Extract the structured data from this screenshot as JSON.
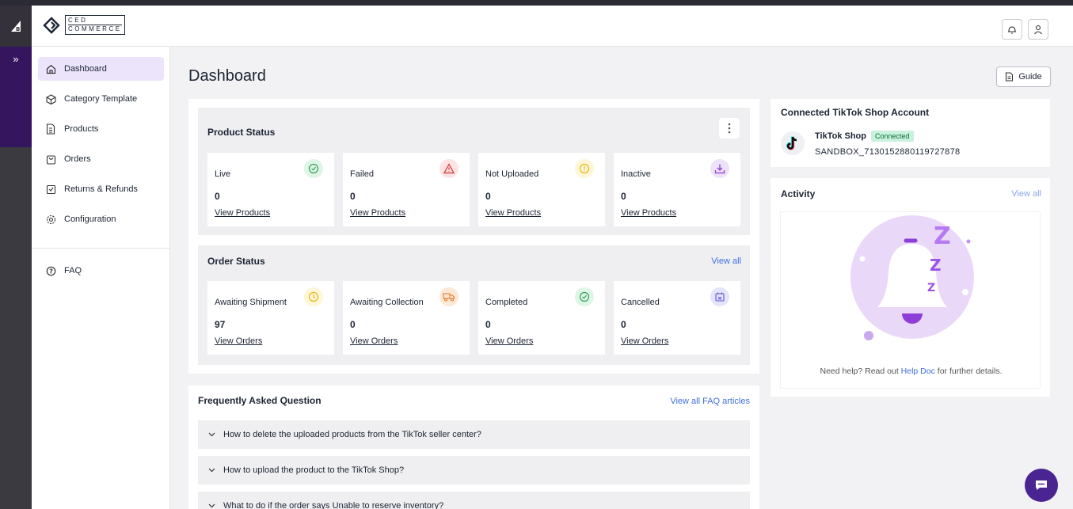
{
  "brand": {
    "line1": "CED",
    "line2": "COMMERCE"
  },
  "rail": {
    "expand_glyph": "»"
  },
  "sidebar": {
    "items": [
      {
        "label": "Dashboard",
        "icon": "home-icon"
      },
      {
        "label": "Category Template",
        "icon": "cube-icon"
      },
      {
        "label": "Products",
        "icon": "document-icon"
      },
      {
        "label": "Orders",
        "icon": "bag-icon"
      },
      {
        "label": "Returns & Refunds",
        "icon": "return-icon"
      },
      {
        "label": "Configuration",
        "icon": "gear-icon"
      }
    ],
    "faq": {
      "label": "FAQ",
      "icon": "help-icon"
    }
  },
  "page": {
    "title": "Dashboard",
    "guide_label": "Guide"
  },
  "product_status": {
    "title": "Product Status",
    "cards": [
      {
        "label": "Live",
        "value": "0",
        "link": "View Products"
      },
      {
        "label": "Failed",
        "value": "0",
        "link": "View Products"
      },
      {
        "label": "Not Uploaded",
        "value": "0",
        "link": "View Products"
      },
      {
        "label": "Inactive",
        "value": "0",
        "link": "View Products"
      }
    ]
  },
  "order_status": {
    "title": "Order Status",
    "view_all": "View all",
    "cards": [
      {
        "label": "Awaiting Shipment",
        "value": "97",
        "link": "View Orders"
      },
      {
        "label": "Awaiting Collection",
        "value": "0",
        "link": "View Orders"
      },
      {
        "label": "Completed",
        "value": "0",
        "link": "View Orders"
      },
      {
        "label": "Cancelled",
        "value": "0",
        "link": "View Orders"
      }
    ]
  },
  "faq": {
    "title": "Frequently Asked Question",
    "view_all": "View all FAQ articles",
    "items": [
      "How to delete the uploaded products from the TikTok seller center?",
      "How to upload the product to the TikTok Shop?",
      "What to do if the order says Unable to reserve inventory?"
    ]
  },
  "account": {
    "title": "Connected TikTok Shop Account",
    "shop_name": "TikTok Shop",
    "status": "Connected",
    "shop_id": "SANDBOX_7130152880119727878"
  },
  "activity": {
    "title": "Activity",
    "view_all": "View all",
    "help_prefix": "Need help? Read out ",
    "help_link": "Help Doc",
    "help_suffix": " for further details."
  },
  "colors": {
    "accent": "#4a2491",
    "active_nav": "#ece4fb",
    "link": "#3d6fe0"
  }
}
